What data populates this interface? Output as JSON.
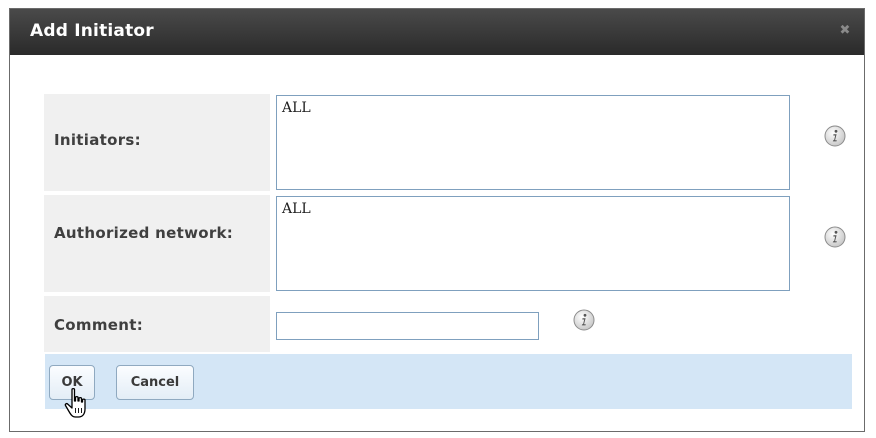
{
  "dialog": {
    "title": "Add Initiator",
    "close_icon": "close-icon"
  },
  "fields": {
    "initiators": {
      "label": "Initiators:",
      "value": "ALL",
      "info_icon": "info-icon"
    },
    "authorized_network": {
      "label": "Authorized network:",
      "value": "ALL",
      "info_icon": "info-icon"
    },
    "comment": {
      "label": "Comment:",
      "value": "",
      "info_icon": "info-icon"
    }
  },
  "buttons": {
    "ok_label": "OK",
    "cancel_label": "Cancel"
  },
  "colors": {
    "titlebar": "#333333",
    "label_bg": "#f0f0f0",
    "button_bar": "#d4e6f6",
    "input_border": "#7fa0be"
  }
}
